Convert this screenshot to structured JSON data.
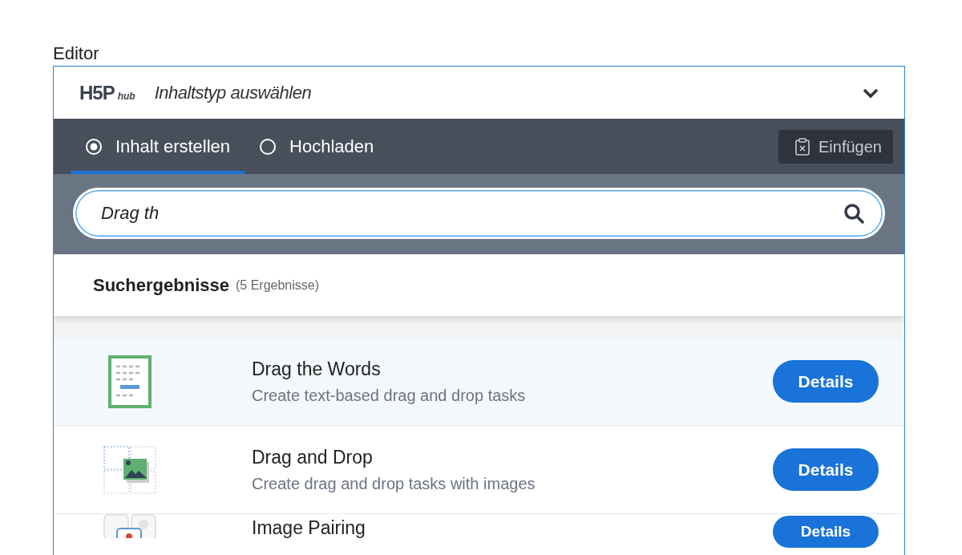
{
  "label": "Editor",
  "header": {
    "logo": "H5P",
    "logo_suffix": "hub",
    "title": "Inhaltstyp auswählen",
    "expanded": true
  },
  "tabs": [
    {
      "label": "Inhalt erstellen",
      "selected": true
    },
    {
      "label": "Hochladen",
      "selected": false
    }
  ],
  "paste_button": {
    "label": "Einfügen"
  },
  "search": {
    "value": "Drag th"
  },
  "results": {
    "title": "Suchergebnisse",
    "count": "(5 Ergebnisse)"
  },
  "items": [
    {
      "kind": "words",
      "title": "Drag the Words",
      "description": "Create text-based drag and drop tasks",
      "button": "Details",
      "selected": true
    },
    {
      "kind": "dragdrop",
      "title": "Drag and Drop",
      "description": "Create drag and drop tasks with images",
      "button": "Details",
      "selected": false
    },
    {
      "kind": "pairing",
      "title": "Image Pairing",
      "button": "Details",
      "selected": false
    }
  ]
}
